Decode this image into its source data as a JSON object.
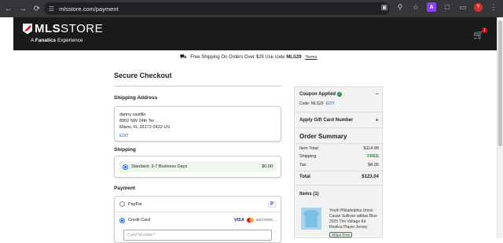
{
  "browser": {
    "url": "mlsstore.com/payment",
    "profile_initial": "Y",
    "extension_label": "A"
  },
  "header": {
    "logo_bold": "MLS",
    "logo_light": "STORE",
    "logo_sub_prefix": "A",
    "logo_sub_brand": "Fanatics",
    "logo_sub_suffix": "Experience",
    "cart_count": "1"
  },
  "promo": {
    "text": "Free Shipping On Orders Over $29 Use code",
    "code": "MLS29",
    "terms": "Terms"
  },
  "checkout": {
    "title": "Secure Checkout",
    "shipping_address_heading": "Shipping Address",
    "address": {
      "name": "danny castillo",
      "line1": "8952 NW 24th Ter",
      "line2": "Miami, FL 33172-2422 US",
      "edit": "EDIT"
    },
    "shipping_heading": "Shipping",
    "shipping_option": {
      "label": "Standard: 3-7 Business Days",
      "price": "$0.00"
    },
    "payment_heading": "Payment",
    "payment_options": [
      {
        "label": "PayPal",
        "badge": "P"
      },
      {
        "label": "Credit Card",
        "card_visa": "VISA",
        "more": "and more..."
      }
    ],
    "card_number_placeholder": "Card Number*"
  },
  "summary": {
    "coupon_label": "Coupon Applied",
    "coupon_code_label": "Code: MLS29",
    "coupon_edit": "EDIT",
    "gift_card_label": "Apply Gift Card Number",
    "order_summary_title": "Order Summary",
    "rows": [
      {
        "label": "Item Total",
        "value": "$114.99"
      },
      {
        "label": "Shipping",
        "value": "FREE"
      },
      {
        "label": "Tax",
        "value": "$8.05"
      }
    ],
    "total_label": "Total",
    "total_value": "$123.04",
    "items_heading": "Items (1)",
    "product_name": "Youth Philadelphia Union Cavan Sullivan adidas Blue 2025 The Voltage Kit Replica Player Jersey",
    "ships_free": "Ships Free"
  },
  "colors": {
    "header_bg": "#1a1a1a",
    "accent_red": "#d0021b",
    "link_blue": "#2f5f9e",
    "success_green": "#2e8b3d"
  }
}
